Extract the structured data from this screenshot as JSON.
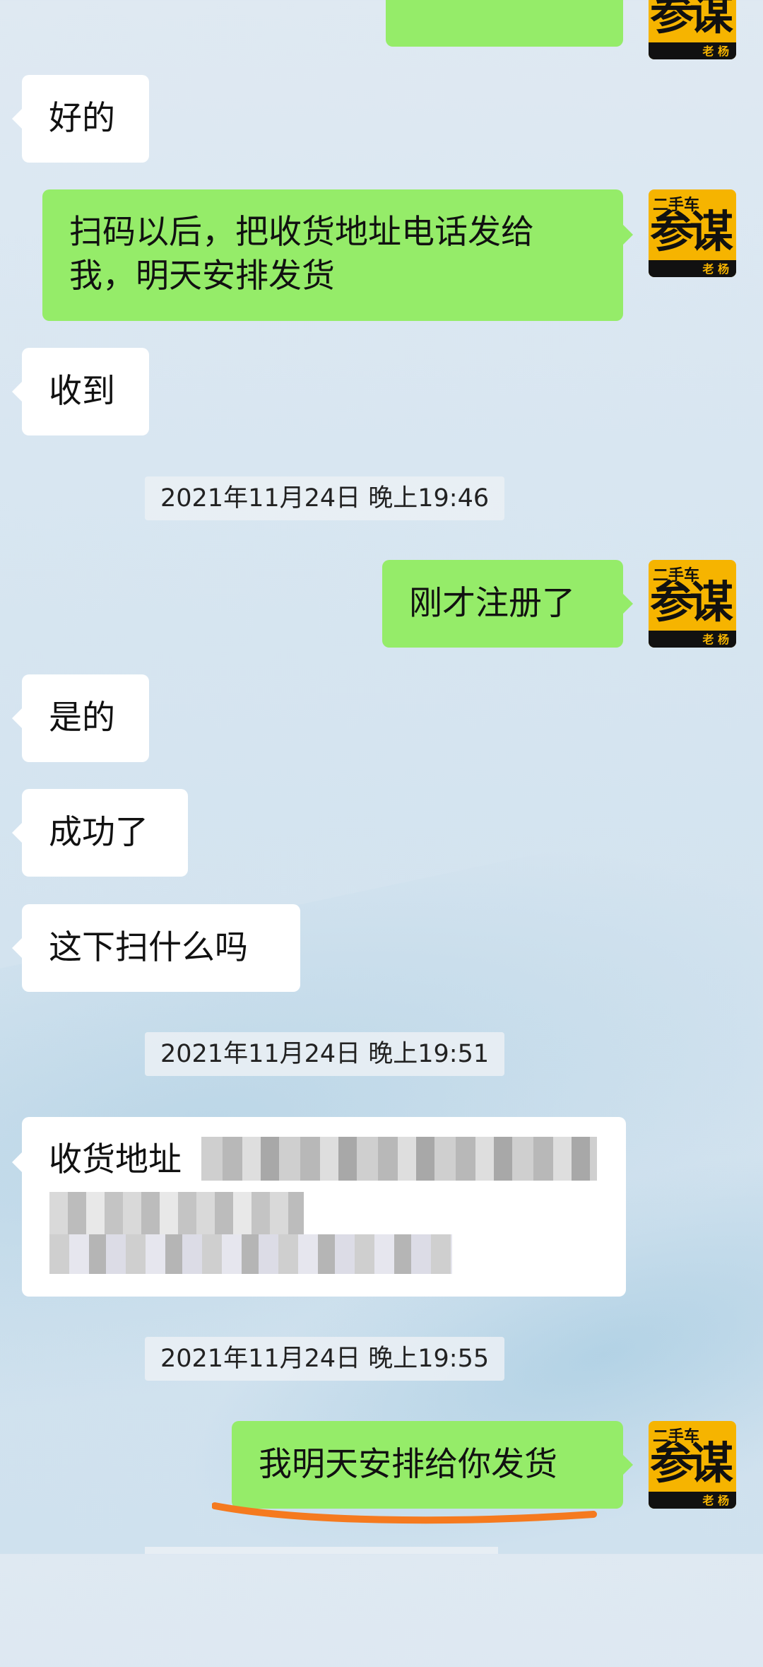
{
  "messages": {
    "m1": "好的",
    "m2_line1": "扫码以后，把收货地址电话发给",
    "m2_line2": "我，明天安排发货",
    "m3": "收到",
    "ts1": "2021年11月24日 晚上19:46",
    "m4": "刚才注册了",
    "m5": "是的",
    "m6": "成功了",
    "m7": "这下扫什么吗",
    "ts2": "2021年11月24日 晚上19:51",
    "m8": "收货地址",
    "ts3": "2021年11月24日 晚上19:55",
    "m9": "我明天安排给你发货"
  },
  "avatar": {
    "top": "二手车",
    "main": "参谋",
    "name": "老 杨"
  },
  "colors": {
    "bubble_self": "#95ec69",
    "bubble_other": "#ffffff",
    "underline": "#f57a1f"
  }
}
